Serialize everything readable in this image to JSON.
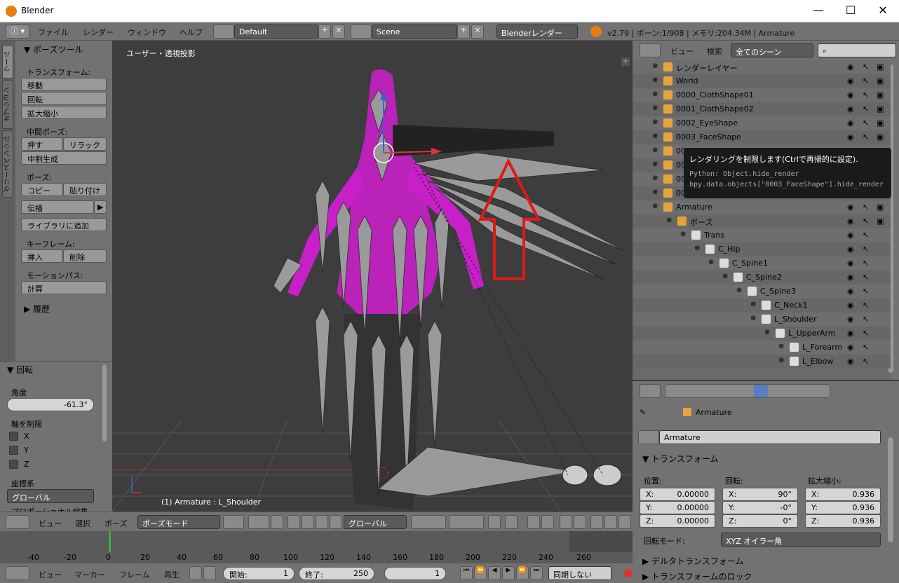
{
  "window": {
    "title": "Blender",
    "minimize": "—",
    "maximize": "☐",
    "close": "✕"
  },
  "menu": {
    "items": [
      "ファイル",
      "レンダー",
      "ウィンドウ",
      "ヘルプ"
    ],
    "layout": "Default",
    "scene": "Scene",
    "engine": "Blenderレンダー",
    "status": "v2.79 | ボーン:1/908 | メモリ:204.34M | Armature"
  },
  "tabs": [
    "ツール",
    "オプション",
    "グリースペンシル"
  ],
  "toolshelf": {
    "title": "ポーズツール",
    "transform_label": "トランスフォーム:",
    "move": "移動",
    "rotate": "回転",
    "scale": "拡大縮小",
    "inbetween_label": "中間ポーズ:",
    "push": "押す",
    "relax": "リラック",
    "breakdown": "中割生成",
    "pose_label": "ポーズ:",
    "copy": "コピー",
    "paste": "貼り付け",
    "propagate": "伝播",
    "add_library": "ライブラリに追加",
    "keyframe_label": "キーフレーム:",
    "insert": "挿入",
    "delete": "削除",
    "motion_label": "モーションパス:",
    "calc": "計算",
    "history": "履歴"
  },
  "redo": {
    "title": "回転",
    "angle_label": "角度",
    "angle": "-61.3°",
    "constraint_label": "軸を制限",
    "x": "X",
    "y": "Y",
    "z": "Z",
    "orient_label": "座標系",
    "orient": "グローバル",
    "extra": "プロポーショナル編集"
  },
  "viewport": {
    "view_label": "ユーザー・透視投影",
    "object_label": "(1) Armature : L_Shoulder"
  },
  "vheader": {
    "view": "ビュー",
    "select": "選択",
    "pose": "ポーズ",
    "mode": "ポーズモード",
    "orient": "グローバル"
  },
  "timeline": {
    "ticks": [
      "-40",
      "-20",
      "0",
      "20",
      "40",
      "60",
      "80",
      "100",
      "120",
      "140",
      "160",
      "180",
      "200",
      "220",
      "240",
      "260"
    ]
  },
  "tlbar": {
    "view": "ビュー",
    "marker": "マーカー",
    "frame": "フレーム",
    "play": "再生",
    "start_label": "開始:",
    "start": "1",
    "end_label": "終了:",
    "end": "250",
    "current": "1",
    "sync": "同期しない"
  },
  "outliner": {
    "view": "ビュー",
    "search": "検索",
    "filter": "全てのシーン",
    "rows": [
      {
        "name": "レンダーレイヤー",
        "indent": 0
      },
      {
        "name": "World",
        "indent": 0
      },
      {
        "name": "0000_ClothShape01",
        "indent": 0
      },
      {
        "name": "0001_ClothShape02",
        "indent": 0
      },
      {
        "name": "0002_EyeShape",
        "indent": 0
      },
      {
        "name": "0003_FaceShape",
        "indent": 0
      },
      {
        "name": "0004_TeethShape",
        "indent": 0
      },
      {
        "name": "0005_...",
        "indent": 0
      },
      {
        "name": "0006_...",
        "indent": 0
      },
      {
        "name": "0007_...",
        "indent": 0
      },
      {
        "name": "Armature",
        "indent": 0
      },
      {
        "name": "ポーズ",
        "indent": 1
      },
      {
        "name": "Trans",
        "indent": 2
      },
      {
        "name": "C_Hip",
        "indent": 3
      },
      {
        "name": "C_Spine1",
        "indent": 4
      },
      {
        "name": "C_Spine2",
        "indent": 5
      },
      {
        "name": "C_Spine3",
        "indent": 6
      },
      {
        "name": "C_Neck1",
        "indent": 7
      },
      {
        "name": "L_Shoulder",
        "indent": 7
      },
      {
        "name": "L_UpperArm",
        "indent": 8
      },
      {
        "name": "L_Forearm",
        "indent": 9
      },
      {
        "name": "L_Elbow",
        "indent": 9
      }
    ]
  },
  "tooltip": {
    "title": "レンダリングを制限します(Ctrlで再帰的に設定).",
    "python": "Python: Object.hide_render",
    "path": "bpy.data.objects[\"0003_FaceShape\"].hide_render"
  },
  "props": {
    "breadcrumb": "Armature",
    "object_name": "Armature",
    "transform_title": "トランスフォーム",
    "loc_label": "位置:",
    "rot_label": "回転:",
    "scale_label": "拡大縮小:",
    "loc": [
      {
        "axis": "X:",
        "val": "0.00000"
      },
      {
        "axis": "Y:",
        "val": "0.00000"
      },
      {
        "axis": "Z:",
        "val": "0.00000"
      }
    ],
    "rot": [
      {
        "axis": "X:",
        "val": "90°"
      },
      {
        "axis": "Y:",
        "val": "-0°"
      },
      {
        "axis": "Z:",
        "val": "0°"
      }
    ],
    "scl": [
      {
        "axis": "X:",
        "val": "0.936"
      },
      {
        "axis": "Y:",
        "val": "0.936"
      },
      {
        "axis": "Z:",
        "val": "0.936"
      }
    ],
    "rotmode_label": "回転モード:",
    "rotmode": "XYZ オイラー角",
    "delta": "デルタトランスフォーム",
    "lock": "トランスフォームのロック"
  }
}
